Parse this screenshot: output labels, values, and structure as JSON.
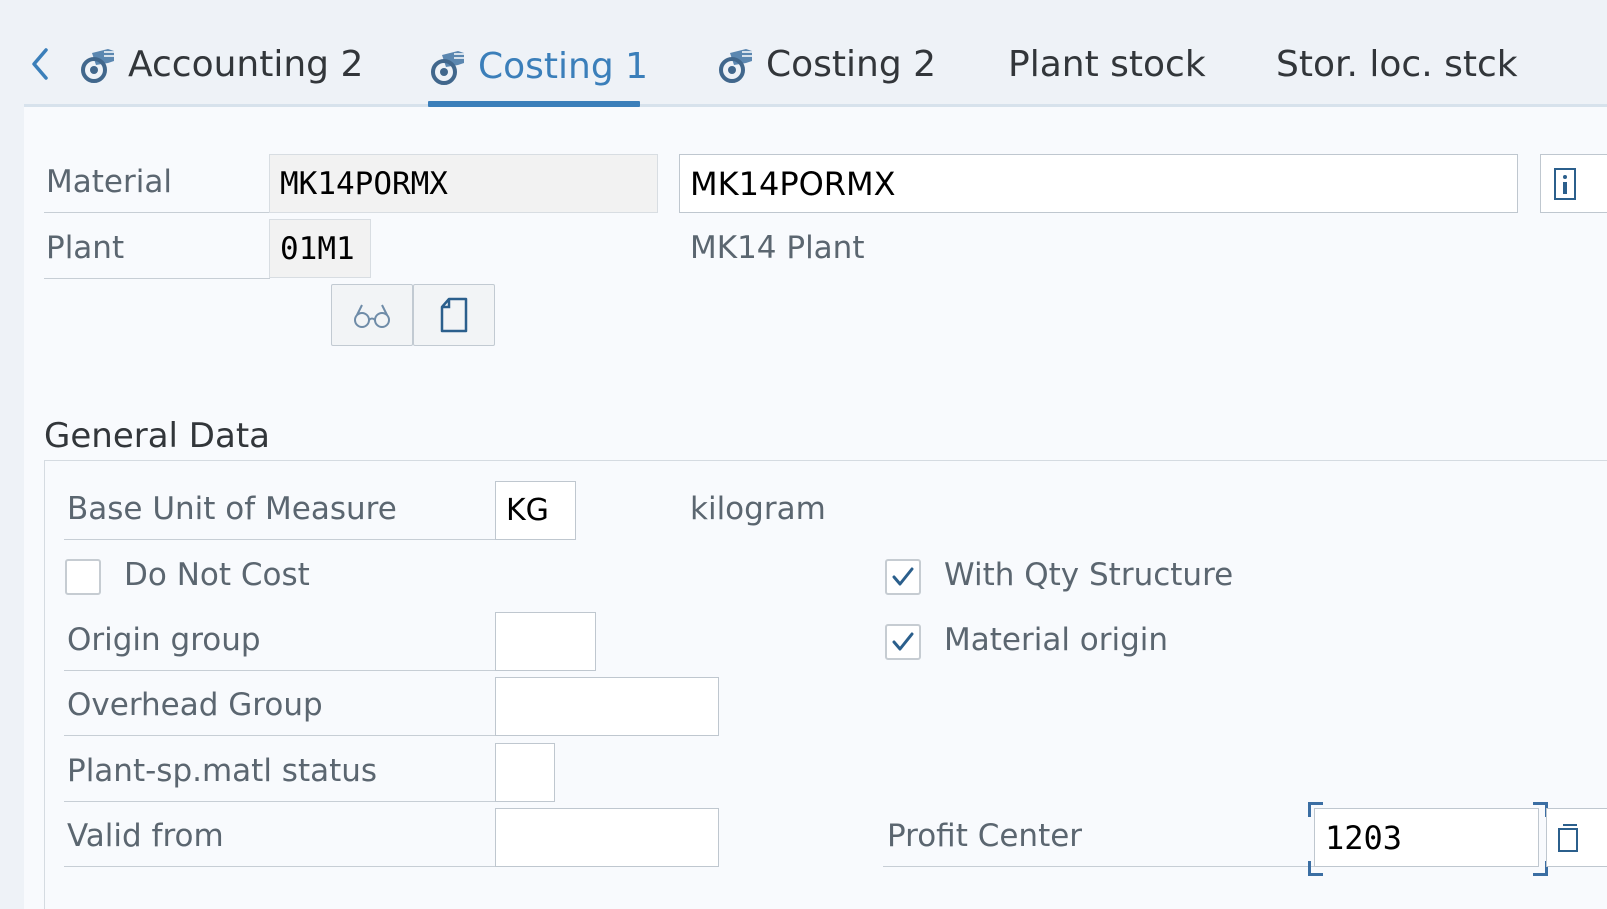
{
  "tabs": {
    "back_icon": "chevron-left-icon",
    "tab_icon": "data-gear-icon",
    "items": [
      {
        "label": "Accounting 2"
      },
      {
        "label": "Costing 1"
      },
      {
        "label": "Costing 2"
      },
      {
        "label": "Plant stock"
      },
      {
        "label": "Stor. loc. stck"
      }
    ],
    "active_index": 1
  },
  "header": {
    "material_label": "Material",
    "material_value": "MK14PORMX",
    "material_description": "MK14PORMX",
    "plant_label": "Plant",
    "plant_value": "01M1",
    "plant_description": "MK14 Plant",
    "display_button_icon": "glasses-icon",
    "document_button_icon": "document-icon"
  },
  "general_data": {
    "title": "General Data",
    "base_uom_label": "Base Unit of Measure",
    "base_uom_value": "KG",
    "base_uom_text": "kilogram",
    "do_not_cost_label": "Do Not Cost",
    "do_not_cost_checked": false,
    "with_qty_structure_label": "With Qty Structure",
    "with_qty_structure_checked": true,
    "origin_group_label": "Origin group",
    "origin_group_value": "",
    "material_origin_label": "Material origin",
    "material_origin_checked": true,
    "overhead_group_label": "Overhead Group",
    "overhead_group_value": "",
    "plant_status_label": "Plant-sp.matl status",
    "plant_status_value": "",
    "valid_from_label": "Valid from",
    "valid_from_value": "",
    "profit_center_label": "Profit Center",
    "profit_center_value": "1203"
  },
  "colors": {
    "accent": "#3b7fba",
    "checkmark": "#2b5f8c",
    "label": "#5b6670"
  }
}
